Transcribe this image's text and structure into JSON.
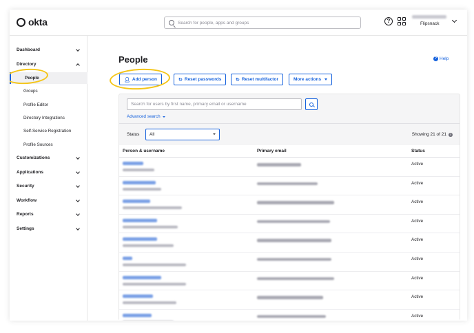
{
  "brand": {
    "name": "okta",
    "accent": "#1662dd",
    "highlight": "#f4c518"
  },
  "topbar": {
    "search_placeholder": "Search for people, apps and groups",
    "org_name": "Flipsnack"
  },
  "sidebar": {
    "sections": [
      {
        "label": "Dashboard",
        "expanded": false
      },
      {
        "label": "Directory",
        "expanded": true
      },
      {
        "label": "Customizations",
        "expanded": false
      },
      {
        "label": "Applications",
        "expanded": false
      },
      {
        "label": "Security",
        "expanded": false
      },
      {
        "label": "Workflow",
        "expanded": false
      },
      {
        "label": "Reports",
        "expanded": false
      },
      {
        "label": "Settings",
        "expanded": false
      }
    ],
    "directory_items": [
      {
        "label": "People",
        "active": true
      },
      {
        "label": "Groups",
        "active": false
      },
      {
        "label": "Profile Editor",
        "active": false
      },
      {
        "label": "Directory Integrations",
        "active": false
      },
      {
        "label": "Self-Service Registration",
        "active": false
      },
      {
        "label": "Profile Sources",
        "active": false
      }
    ]
  },
  "main": {
    "title": "People",
    "help_label": "Help",
    "actions": {
      "add_person": "Add person",
      "reset_passwords": "Reset passwords",
      "reset_multifactor": "Reset multifactor",
      "more_actions": "More actions"
    },
    "filter": {
      "placeholder": "Search for users by first name, primary email or username",
      "advanced_search": "Advanced search"
    },
    "status_filter": {
      "label": "Status",
      "value": "All"
    },
    "showing": "Showing 21 of 21",
    "table": {
      "headers": {
        "person": "Person & username",
        "email": "Primary email",
        "status": "Status"
      },
      "rows": [
        {
          "status": "Active"
        },
        {
          "status": "Active"
        },
        {
          "status": "Active"
        },
        {
          "status": "Active"
        },
        {
          "status": "Active"
        },
        {
          "status": "Active"
        },
        {
          "status": "Active"
        },
        {
          "status": "Active"
        },
        {
          "status": "Active"
        }
      ]
    }
  }
}
